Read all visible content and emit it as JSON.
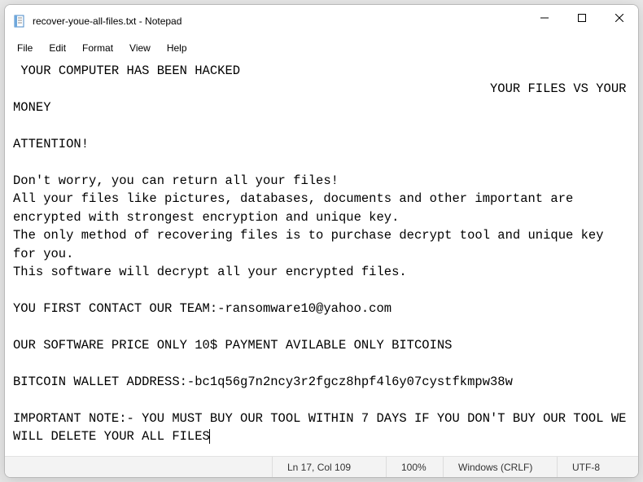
{
  "window": {
    "title": "recover-youe-all-files.txt - Notepad"
  },
  "menu": {
    "items": [
      "File",
      "Edit",
      "Format",
      "View",
      "Help"
    ]
  },
  "body_text": " YOUR COMPUTER HAS BEEN HACKED\n                                                               YOUR FILES VS YOUR MONEY\n\nATTENTION!\n\nDon't worry, you can return all your files!\nAll your files like pictures, databases, documents and other important are encrypted with strongest encryption and unique key.\nThe only method of recovering files is to purchase decrypt tool and unique key for you.\nThis software will decrypt all your encrypted files.\n\nYOU FIRST CONTACT OUR TEAM:-ransomware10@yahoo.com\n\nOUR SOFTWARE PRICE ONLY 10$ PAYMENT AVILABLE ONLY BITCOINS\n\nBITCOIN WALLET ADDRESS:-bc1q56g7n2ncy3r2fgcz8hpf4l6y07cystfkmpw38w\n\nIMPORTANT NOTE:- YOU MUST BUY OUR TOOL WITHIN 7 DAYS IF YOU DON'T BUY OUR TOOL WE WILL DELETE YOUR ALL FILES",
  "status": {
    "position": "Ln 17, Col 109",
    "zoom": "100%",
    "line_ending": "Windows (CRLF)",
    "encoding": "UTF-8"
  }
}
